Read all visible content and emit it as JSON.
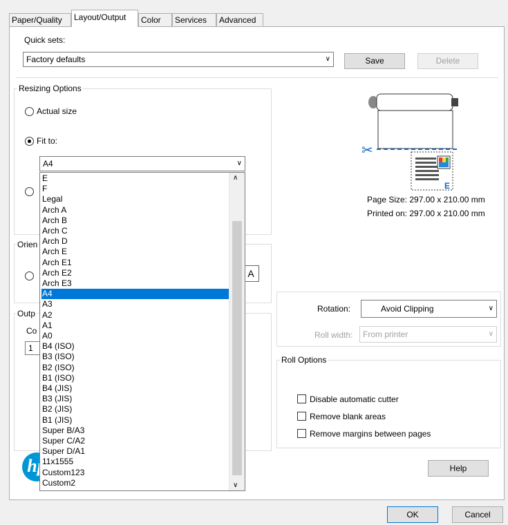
{
  "tabs": [
    {
      "label": "Paper/Quality"
    },
    {
      "label": "Layout/Output"
    },
    {
      "label": "Color"
    },
    {
      "label": "Services"
    },
    {
      "label": "Advanced"
    }
  ],
  "quick_sets": {
    "label": "Quick sets:",
    "value": "Factory defaults",
    "save": "Save",
    "delete": "Delete"
  },
  "resizing": {
    "label": "Resizing Options",
    "actual_size": "Actual size",
    "fit_to": "Fit to:",
    "fit_value": "A4",
    "fit_to_selected": true
  },
  "paper_list": {
    "selected": "A4",
    "items": [
      "E",
      "F",
      "Legal",
      "Arch A",
      "Arch B",
      "Arch C",
      "Arch D",
      "Arch E",
      "Arch E1",
      "Arch E2",
      "Arch E3",
      "A4",
      "A3",
      "A2",
      "A1",
      "A0",
      "B4 (ISO)",
      "B3 (ISO)",
      "B2 (ISO)",
      "B1 (ISO)",
      "B4 (JIS)",
      "B3 (JIS)",
      "B2 (JIS)",
      "B1 (JIS)",
      "Super B/A3",
      "Super C/A2",
      "Super D/A1",
      "11x1555",
      "Custom123",
      "Custom2"
    ]
  },
  "orientation": {
    "label_partial": "Orien",
    "landscape_glyph": "A"
  },
  "output": {
    "label_partial": "Outp",
    "copies_partial": "Co",
    "copies_value": "1"
  },
  "preview": {
    "page_size": "Page Size: 297.00 x 210.00 mm",
    "printed_on": "Printed on: 297.00 x 210.00 mm"
  },
  "rotation": {
    "label": "Rotation:",
    "value": "Avoid Clipping",
    "roll_width_label": "Roll width:",
    "roll_width_value": "From printer"
  },
  "roll_options": {
    "label": "Roll Options",
    "items": [
      {
        "label": "Disable automatic cutter",
        "checked": false
      },
      {
        "label": "Remove blank areas",
        "checked": false
      },
      {
        "label": "Remove margins between pages",
        "checked": false
      }
    ]
  },
  "buttons": {
    "help": "Help",
    "ok": "OK",
    "cancel": "Cancel"
  },
  "logo_text": "hp",
  "colors": {
    "selection": "#0078d7",
    "logo": "#0096d6"
  }
}
